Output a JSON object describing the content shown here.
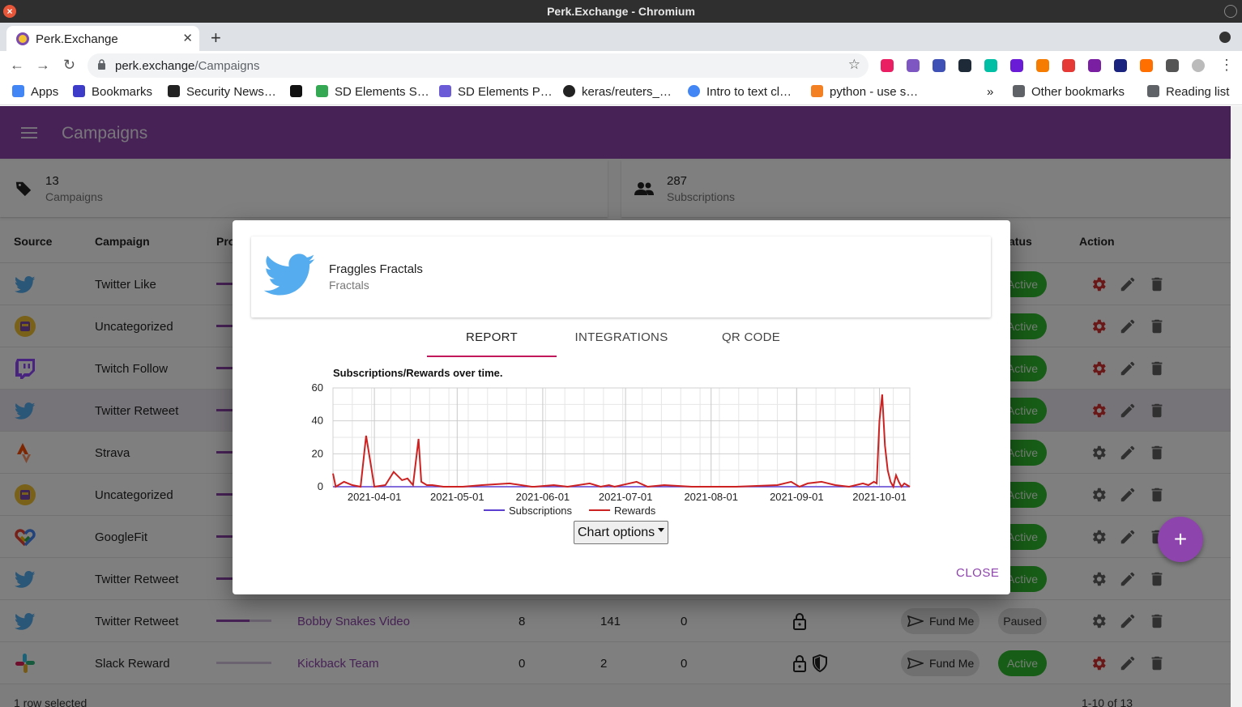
{
  "window": {
    "title": "Perk.Exchange - Chromium",
    "close_glyph": "×"
  },
  "browser": {
    "tab_title": "Perk.Exchange",
    "tab_close": "✕",
    "new_tab": "+",
    "url_host": "perk.exchange",
    "url_path": "/Campaigns",
    "back": "←",
    "forward": "→",
    "reload": "↻",
    "star": "☆",
    "menu": "⋮",
    "extension_icons": [
      "monero-icon",
      "video-icon",
      "1password-icon",
      "react-icon",
      "ghost-icon",
      "arrow-ext-icon",
      "metamask-icon",
      "x-ext-icon",
      "ext-circle-icon",
      "check-circle-icon",
      "spark-icon",
      "puzzle-icon",
      "profile-icon"
    ]
  },
  "bookmarks": {
    "items": [
      "Apps",
      "Bookmarks",
      "Security News…",
      "SD Elements S…",
      "SD Elements P…",
      "keras/reuters_…",
      "Intro to text cl…",
      "python - use s…"
    ],
    "more": "»",
    "other": "Other bookmarks",
    "reading_list": "Reading list"
  },
  "app": {
    "title": "Campaigns",
    "stats": [
      {
        "value": "13",
        "label": "Campaigns"
      },
      {
        "value": "287",
        "label": "Subscriptions"
      }
    ],
    "columns": {
      "source": "Source",
      "campaign": "Campaign",
      "promotion": "Pro",
      "status": "atus",
      "action": "Action"
    },
    "rows": [
      {
        "source": "twitter",
        "campaign": "Twitter Like",
        "status": "Active",
        "gear_red": true
      },
      {
        "source": "perk",
        "campaign": "Uncategorized",
        "status": "Active",
        "gear_red": true
      },
      {
        "source": "twitch",
        "campaign": "Twitch Follow",
        "status": "Active",
        "gear_red": true
      },
      {
        "source": "twitter",
        "campaign": "Twitter Retweet",
        "status": "Active",
        "gear_red": true,
        "selected": true
      },
      {
        "source": "strava",
        "campaign": "Strava",
        "status": "Active",
        "gear_red": false
      },
      {
        "source": "perk",
        "campaign": "Uncategorized",
        "status": "Active",
        "gear_red": false
      },
      {
        "source": "googlefit",
        "campaign": "GoogleFit",
        "status": "Active",
        "gear_red": false
      },
      {
        "source": "twitter",
        "campaign": "Twitter Retweet",
        "status": "Active",
        "gear_red": false
      },
      {
        "source": "twitter",
        "campaign": "Twitter Retweet",
        "promotion": "Bobby Snakes Video",
        "c1": "8",
        "c2": "141",
        "c3": "0",
        "fund": "Fund Me",
        "status": "Paused",
        "gear_red": false
      },
      {
        "source": "slack",
        "campaign": "Slack Reward",
        "promotion": "Kickback Team",
        "c1": "0",
        "c2": "2",
        "c3": "0",
        "fund": "Fund Me",
        "status": "Active",
        "gear_red": true
      }
    ],
    "footer_selected": "1 row selected",
    "footer_pagination": "1-10 of 13",
    "fab": "+"
  },
  "dialog": {
    "title": "Fraggles Fractals",
    "subtitle": "Fractals",
    "tabs": [
      "REPORT",
      "INTEGRATIONS",
      "QR CODE"
    ],
    "active_tab": 0,
    "chart_options": "Chart options",
    "close": "CLOSE"
  },
  "chart_data": {
    "type": "line",
    "title": "Subscriptions/Rewards over time.",
    "xlabel": "",
    "ylabel": "",
    "ylim": [
      0,
      60
    ],
    "yticks": [
      0,
      20,
      40,
      60
    ],
    "xticks": [
      "2021-04-01",
      "2021-05-01",
      "2021-06-01",
      "2021-07-01",
      "2021-08-01",
      "2021-09-01",
      "2021-10-01"
    ],
    "xrange": [
      "2021-03-17",
      "2021-10-12"
    ],
    "legend_position": "bottom",
    "colors": {
      "Subscriptions": "#5b3fd1",
      "Rewards": "#cc2222"
    },
    "series": [
      {
        "name": "Subscriptions",
        "x": [
          "2021-03-17",
          "2021-10-12"
        ],
        "y": [
          0,
          0
        ]
      },
      {
        "name": "Rewards",
        "x": [
          "2021-03-17",
          "2021-03-18",
          "2021-03-21",
          "2021-03-24",
          "2021-03-27",
          "2021-03-29",
          "2021-04-01",
          "2021-04-05",
          "2021-04-08",
          "2021-04-11",
          "2021-04-13",
          "2021-04-15",
          "2021-04-17",
          "2021-04-18",
          "2021-04-20",
          "2021-04-22",
          "2021-04-26",
          "2021-05-03",
          "2021-05-10",
          "2021-05-20",
          "2021-05-28",
          "2021-05-29",
          "2021-06-05",
          "2021-06-10",
          "2021-06-18",
          "2021-06-22",
          "2021-06-25",
          "2021-06-27",
          "2021-07-05",
          "2021-07-09",
          "2021-07-15",
          "2021-07-25",
          "2021-08-10",
          "2021-08-25",
          "2021-08-30",
          "2021-09-02",
          "2021-09-05",
          "2021-09-10",
          "2021-09-15",
          "2021-09-20",
          "2021-09-25",
          "2021-09-27",
          "2021-09-29",
          "2021-09-30",
          "2021-10-01",
          "2021-10-02",
          "2021-10-03",
          "2021-10-04",
          "2021-10-05",
          "2021-10-06",
          "2021-10-07",
          "2021-10-08",
          "2021-10-09",
          "2021-10-10",
          "2021-10-11",
          "2021-10-12"
        ],
        "y": [
          8,
          0,
          3,
          1,
          0,
          31,
          0,
          1,
          9,
          4,
          5,
          1,
          29,
          3,
          1,
          1,
          0,
          0,
          1,
          2,
          0,
          0,
          1,
          0,
          2,
          0,
          1,
          0,
          3,
          0,
          1,
          0,
          0,
          1,
          3,
          0,
          2,
          3,
          1,
          0,
          2,
          1,
          3,
          2,
          40,
          56,
          25,
          10,
          3,
          0,
          7,
          3,
          0,
          2,
          1,
          0
        ]
      }
    ]
  }
}
